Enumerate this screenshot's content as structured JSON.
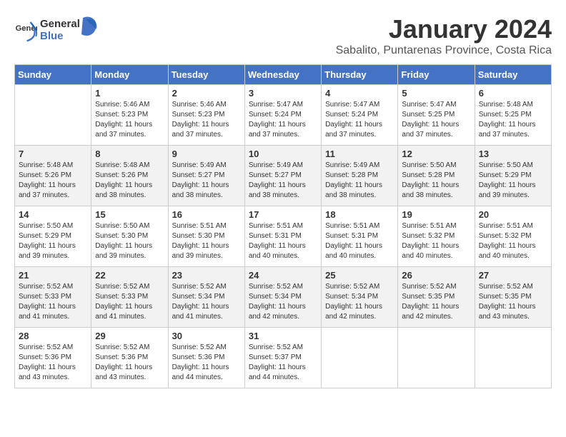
{
  "header": {
    "logo_general": "General",
    "logo_blue": "Blue",
    "month_title": "January 2024",
    "location": "Sabalito, Puntarenas Province, Costa Rica"
  },
  "days_of_week": [
    "Sunday",
    "Monday",
    "Tuesday",
    "Wednesday",
    "Thursday",
    "Friday",
    "Saturday"
  ],
  "weeks": [
    [
      {
        "day": "",
        "sunrise": "",
        "sunset": "",
        "daylight": ""
      },
      {
        "day": "1",
        "sunrise": "Sunrise: 5:46 AM",
        "sunset": "Sunset: 5:23 PM",
        "daylight": "Daylight: 11 hours and 37 minutes."
      },
      {
        "day": "2",
        "sunrise": "Sunrise: 5:46 AM",
        "sunset": "Sunset: 5:23 PM",
        "daylight": "Daylight: 11 hours and 37 minutes."
      },
      {
        "day": "3",
        "sunrise": "Sunrise: 5:47 AM",
        "sunset": "Sunset: 5:24 PM",
        "daylight": "Daylight: 11 hours and 37 minutes."
      },
      {
        "day": "4",
        "sunrise": "Sunrise: 5:47 AM",
        "sunset": "Sunset: 5:24 PM",
        "daylight": "Daylight: 11 hours and 37 minutes."
      },
      {
        "day": "5",
        "sunrise": "Sunrise: 5:47 AM",
        "sunset": "Sunset: 5:25 PM",
        "daylight": "Daylight: 11 hours and 37 minutes."
      },
      {
        "day": "6",
        "sunrise": "Sunrise: 5:48 AM",
        "sunset": "Sunset: 5:25 PM",
        "daylight": "Daylight: 11 hours and 37 minutes."
      }
    ],
    [
      {
        "day": "7",
        "sunrise": "Sunrise: 5:48 AM",
        "sunset": "Sunset: 5:26 PM",
        "daylight": "Daylight: 11 hours and 37 minutes."
      },
      {
        "day": "8",
        "sunrise": "Sunrise: 5:48 AM",
        "sunset": "Sunset: 5:26 PM",
        "daylight": "Daylight: 11 hours and 38 minutes."
      },
      {
        "day": "9",
        "sunrise": "Sunrise: 5:49 AM",
        "sunset": "Sunset: 5:27 PM",
        "daylight": "Daylight: 11 hours and 38 minutes."
      },
      {
        "day": "10",
        "sunrise": "Sunrise: 5:49 AM",
        "sunset": "Sunset: 5:27 PM",
        "daylight": "Daylight: 11 hours and 38 minutes."
      },
      {
        "day": "11",
        "sunrise": "Sunrise: 5:49 AM",
        "sunset": "Sunset: 5:28 PM",
        "daylight": "Daylight: 11 hours and 38 minutes."
      },
      {
        "day": "12",
        "sunrise": "Sunrise: 5:50 AM",
        "sunset": "Sunset: 5:28 PM",
        "daylight": "Daylight: 11 hours and 38 minutes."
      },
      {
        "day": "13",
        "sunrise": "Sunrise: 5:50 AM",
        "sunset": "Sunset: 5:29 PM",
        "daylight": "Daylight: 11 hours and 39 minutes."
      }
    ],
    [
      {
        "day": "14",
        "sunrise": "Sunrise: 5:50 AM",
        "sunset": "Sunset: 5:29 PM",
        "daylight": "Daylight: 11 hours and 39 minutes."
      },
      {
        "day": "15",
        "sunrise": "Sunrise: 5:50 AM",
        "sunset": "Sunset: 5:30 PM",
        "daylight": "Daylight: 11 hours and 39 minutes."
      },
      {
        "day": "16",
        "sunrise": "Sunrise: 5:51 AM",
        "sunset": "Sunset: 5:30 PM",
        "daylight": "Daylight: 11 hours and 39 minutes."
      },
      {
        "day": "17",
        "sunrise": "Sunrise: 5:51 AM",
        "sunset": "Sunset: 5:31 PM",
        "daylight": "Daylight: 11 hours and 40 minutes."
      },
      {
        "day": "18",
        "sunrise": "Sunrise: 5:51 AM",
        "sunset": "Sunset: 5:31 PM",
        "daylight": "Daylight: 11 hours and 40 minutes."
      },
      {
        "day": "19",
        "sunrise": "Sunrise: 5:51 AM",
        "sunset": "Sunset: 5:32 PM",
        "daylight": "Daylight: 11 hours and 40 minutes."
      },
      {
        "day": "20",
        "sunrise": "Sunrise: 5:51 AM",
        "sunset": "Sunset: 5:32 PM",
        "daylight": "Daylight: 11 hours and 40 minutes."
      }
    ],
    [
      {
        "day": "21",
        "sunrise": "Sunrise: 5:52 AM",
        "sunset": "Sunset: 5:33 PM",
        "daylight": "Daylight: 11 hours and 41 minutes."
      },
      {
        "day": "22",
        "sunrise": "Sunrise: 5:52 AM",
        "sunset": "Sunset: 5:33 PM",
        "daylight": "Daylight: 11 hours and 41 minutes."
      },
      {
        "day": "23",
        "sunrise": "Sunrise: 5:52 AM",
        "sunset": "Sunset: 5:34 PM",
        "daylight": "Daylight: 11 hours and 41 minutes."
      },
      {
        "day": "24",
        "sunrise": "Sunrise: 5:52 AM",
        "sunset": "Sunset: 5:34 PM",
        "daylight": "Daylight: 11 hours and 42 minutes."
      },
      {
        "day": "25",
        "sunrise": "Sunrise: 5:52 AM",
        "sunset": "Sunset: 5:34 PM",
        "daylight": "Daylight: 11 hours and 42 minutes."
      },
      {
        "day": "26",
        "sunrise": "Sunrise: 5:52 AM",
        "sunset": "Sunset: 5:35 PM",
        "daylight": "Daylight: 11 hours and 42 minutes."
      },
      {
        "day": "27",
        "sunrise": "Sunrise: 5:52 AM",
        "sunset": "Sunset: 5:35 PM",
        "daylight": "Daylight: 11 hours and 43 minutes."
      }
    ],
    [
      {
        "day": "28",
        "sunrise": "Sunrise: 5:52 AM",
        "sunset": "Sunset: 5:36 PM",
        "daylight": "Daylight: 11 hours and 43 minutes."
      },
      {
        "day": "29",
        "sunrise": "Sunrise: 5:52 AM",
        "sunset": "Sunset: 5:36 PM",
        "daylight": "Daylight: 11 hours and 43 minutes."
      },
      {
        "day": "30",
        "sunrise": "Sunrise: 5:52 AM",
        "sunset": "Sunset: 5:36 PM",
        "daylight": "Daylight: 11 hours and 44 minutes."
      },
      {
        "day": "31",
        "sunrise": "Sunrise: 5:52 AM",
        "sunset": "Sunset: 5:37 PM",
        "daylight": "Daylight: 11 hours and 44 minutes."
      },
      {
        "day": "",
        "sunrise": "",
        "sunset": "",
        "daylight": ""
      },
      {
        "day": "",
        "sunrise": "",
        "sunset": "",
        "daylight": ""
      },
      {
        "day": "",
        "sunrise": "",
        "sunset": "",
        "daylight": ""
      }
    ]
  ]
}
